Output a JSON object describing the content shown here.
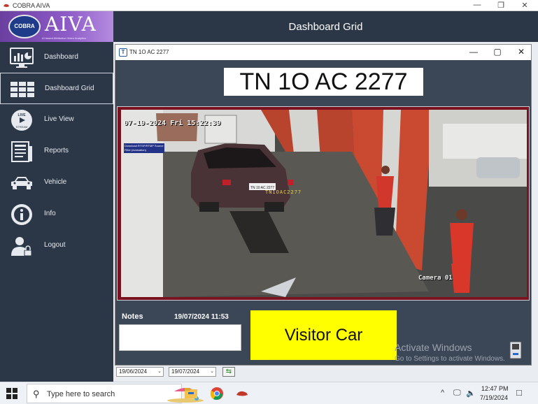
{
  "window": {
    "title": "COBRA AIVA",
    "minimize": "—",
    "maximize": "❐",
    "close": "✕"
  },
  "brand": {
    "badge_text": "COBRA",
    "name": "AIVA",
    "tagline": "AI based Attribution Video Analytics"
  },
  "header": {
    "title": "Dashboard Grid"
  },
  "sidebar": {
    "items": [
      {
        "label": "Dashboard",
        "icon": "dashboard-chart-icon"
      },
      {
        "label": "Dashboard Grid",
        "icon": "grid-icon",
        "active": true
      },
      {
        "label": "Live View",
        "icon": "live-stream-icon",
        "icon_text_top": "LIVE",
        "icon_text_bottom": "STREAM"
      },
      {
        "label": "Reports",
        "icon": "reports-icon"
      },
      {
        "label": "Vehicle",
        "icon": "car-icon"
      },
      {
        "label": "Info",
        "icon": "info-icon"
      },
      {
        "label": "Logout",
        "icon": "logout-user-icon"
      }
    ]
  },
  "dialog": {
    "title": "TN 1O AC 2277",
    "icon_text": "T",
    "plate": "TN 1O AC 2277",
    "camera": {
      "timestamp": "07-19-2024 Fri 15:22:39",
      "watermark": "Download RTSP/RTMP Source Filter (evaluation)",
      "label": "Camera 01",
      "ocr_text": "TN1OAC2277",
      "car_plate": "TN 10 AC 2277"
    },
    "notes_label": "Notes",
    "notes_time": "19/07/2024 11:53",
    "notes_value": "",
    "category": "Visitor Car"
  },
  "filters": {
    "from_date": "19/06/2024",
    "to_date": "19/07/2024",
    "refresh_icon": "refresh-icon"
  },
  "watermark": {
    "line1": "Activate Windows",
    "line2": "Go to Settings to activate Windows."
  },
  "taskbar": {
    "search_placeholder": "Type here to search",
    "time": "12:47 PM",
    "date": "7/19/2024",
    "tray": {
      "chevron": "^",
      "network": "🖵",
      "volume": "🔈"
    },
    "notification_icon": "□"
  }
}
